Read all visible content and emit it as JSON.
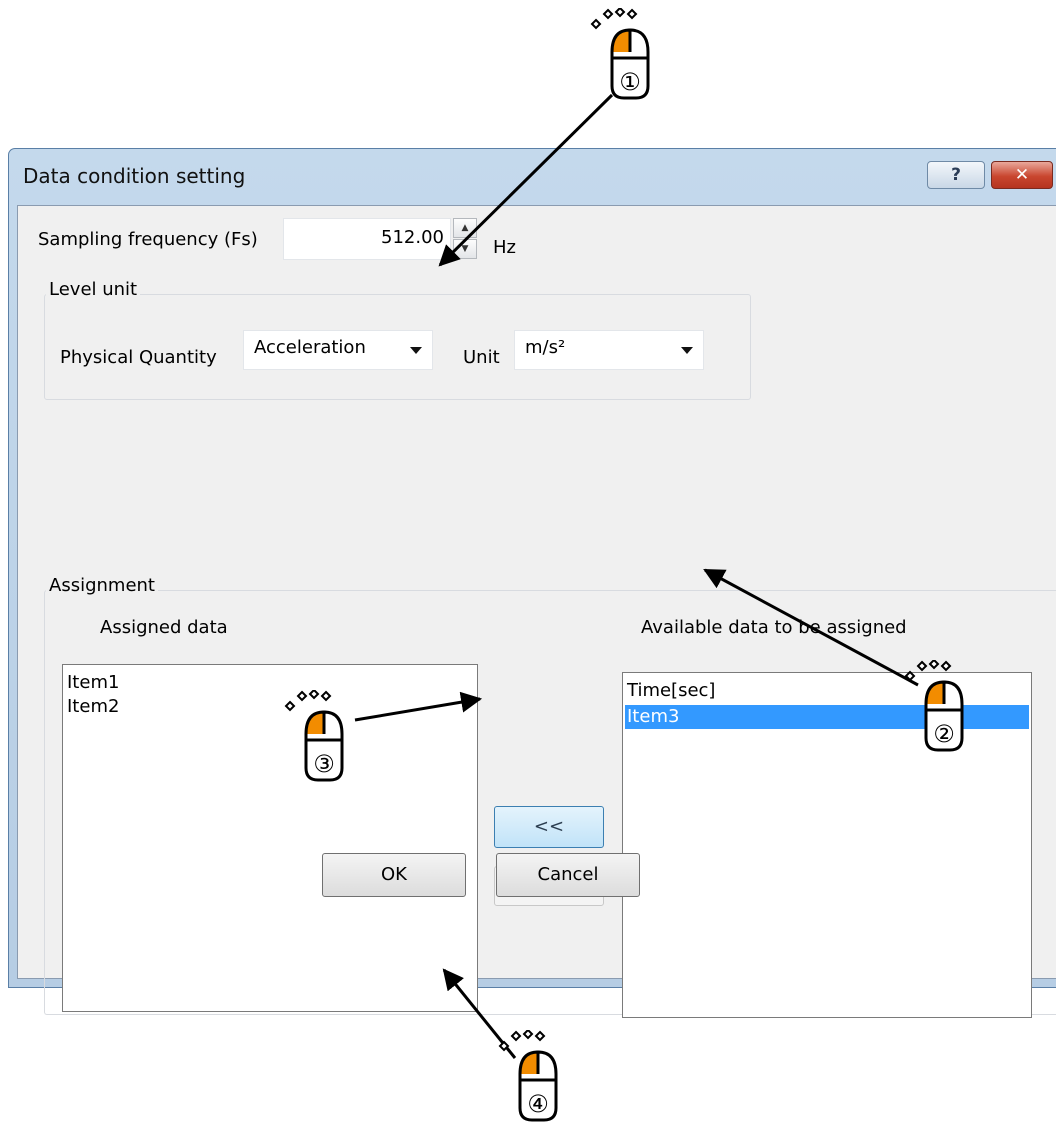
{
  "window": {
    "title": "Data condition setting",
    "help_label": "?",
    "close_label": "✕"
  },
  "sampling": {
    "label": "Sampling frequency (Fs)",
    "value": "512.00",
    "unit": "Hz",
    "spin_up": "▲",
    "spin_down": "▼"
  },
  "level_unit": {
    "group_label": "Level unit",
    "physical_quantity_label": "Physical Quantity",
    "physical_quantity_value": "Acceleration",
    "unit_label": "Unit",
    "unit_value": "m/s²"
  },
  "assignment": {
    "group_label": "Assignment",
    "assigned_label": "Assigned data",
    "available_label": "Available data to be assigned",
    "assigned_items": [
      "Item1",
      "Item2"
    ],
    "available_items": [
      "Time[sec]",
      "Item3"
    ],
    "selected_available_index": 1,
    "move_left_label": "<<",
    "move_right_label": ">>"
  },
  "footer": {
    "ok_label": "OK",
    "cancel_label": "Cancel"
  },
  "annotations": {
    "step_numbers": [
      "①",
      "②",
      "③",
      "④"
    ],
    "mouse_button_highlight": "#f28c00",
    "mouse_icon_name": "mouse-left-click-icon"
  }
}
